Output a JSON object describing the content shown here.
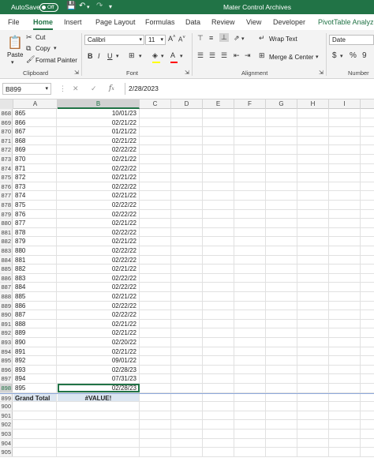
{
  "titlebar": {
    "autosave_label": "AutoSave",
    "autosave_state": "Off",
    "title": "Mater Control Archives"
  },
  "tabs": [
    "File",
    "Home",
    "Insert",
    "Page Layout",
    "Formulas",
    "Data",
    "Review",
    "View",
    "Developer",
    "PivotTable Analyze"
  ],
  "ribbon": {
    "clipboard": {
      "paste": "Paste",
      "cut": "Cut",
      "copy": "Copy",
      "format_painter": "Format Painter",
      "group": "Clipboard"
    },
    "font": {
      "name": "Calibri",
      "size": "11",
      "group": "Font"
    },
    "alignment": {
      "wrap": "Wrap Text",
      "merge": "Merge & Center",
      "group": "Alignment"
    },
    "number": {
      "format": "Date",
      "group": "Number"
    }
  },
  "formula_bar": {
    "name_box": "B899",
    "content": "2/28/2023"
  },
  "columns": [
    "A",
    "B",
    "C",
    "D",
    "E",
    "F",
    "G",
    "H",
    "I"
  ],
  "rows": [
    {
      "n": "868",
      "a": "865",
      "b": "10/01/23"
    },
    {
      "n": "869",
      "a": "866",
      "b": "02/21/22"
    },
    {
      "n": "870",
      "a": "867",
      "b": "01/21/22"
    },
    {
      "n": "871",
      "a": "868",
      "b": "02/21/22"
    },
    {
      "n": "872",
      "a": "869",
      "b": "02/22/22"
    },
    {
      "n": "873",
      "a": "870",
      "b": "02/21/22"
    },
    {
      "n": "874",
      "a": "871",
      "b": "02/22/22"
    },
    {
      "n": "875",
      "a": "872",
      "b": "02/21/22"
    },
    {
      "n": "876",
      "a": "873",
      "b": "02/22/22"
    },
    {
      "n": "877",
      "a": "874",
      "b": "02/21/22"
    },
    {
      "n": "878",
      "a": "875",
      "b": "02/22/22"
    },
    {
      "n": "879",
      "a": "876",
      "b": "02/22/22"
    },
    {
      "n": "880",
      "a": "877",
      "b": "02/21/22"
    },
    {
      "n": "881",
      "a": "878",
      "b": "02/22/22"
    },
    {
      "n": "882",
      "a": "879",
      "b": "02/21/22"
    },
    {
      "n": "883",
      "a": "880",
      "b": "02/22/22"
    },
    {
      "n": "884",
      "a": "881",
      "b": "02/22/22"
    },
    {
      "n": "885",
      "a": "882",
      "b": "02/21/22"
    },
    {
      "n": "886",
      "a": "883",
      "b": "02/22/22"
    },
    {
      "n": "887",
      "a": "884",
      "b": "02/22/22"
    },
    {
      "n": "888",
      "a": "885",
      "b": "02/21/22"
    },
    {
      "n": "889",
      "a": "886",
      "b": "02/22/22"
    },
    {
      "n": "890",
      "a": "887",
      "b": "02/22/22"
    },
    {
      "n": "891",
      "a": "888",
      "b": "02/21/22"
    },
    {
      "n": "892",
      "a": "889",
      "b": "02/21/22"
    },
    {
      "n": "893",
      "a": "890",
      "b": "02/20/22"
    },
    {
      "n": "894",
      "a": "891",
      "b": "02/21/22"
    },
    {
      "n": "895",
      "a": "892",
      "b": "09/01/22"
    },
    {
      "n": "896",
      "a": "893",
      "b": "02/28/23"
    },
    {
      "n": "897",
      "a": "894",
      "b": "07/31/23"
    },
    {
      "n": "898",
      "a": "895",
      "b": "02/28/23"
    },
    {
      "n": "899",
      "a": "Grand Total",
      "b": "#VALUE!"
    },
    {
      "n": "900",
      "a": "",
      "b": ""
    },
    {
      "n": "901",
      "a": "",
      "b": ""
    },
    {
      "n": "902",
      "a": "",
      "b": ""
    },
    {
      "n": "903",
      "a": "",
      "b": ""
    },
    {
      "n": "904",
      "a": "",
      "b": ""
    },
    {
      "n": "905",
      "a": "",
      "b": ""
    }
  ]
}
